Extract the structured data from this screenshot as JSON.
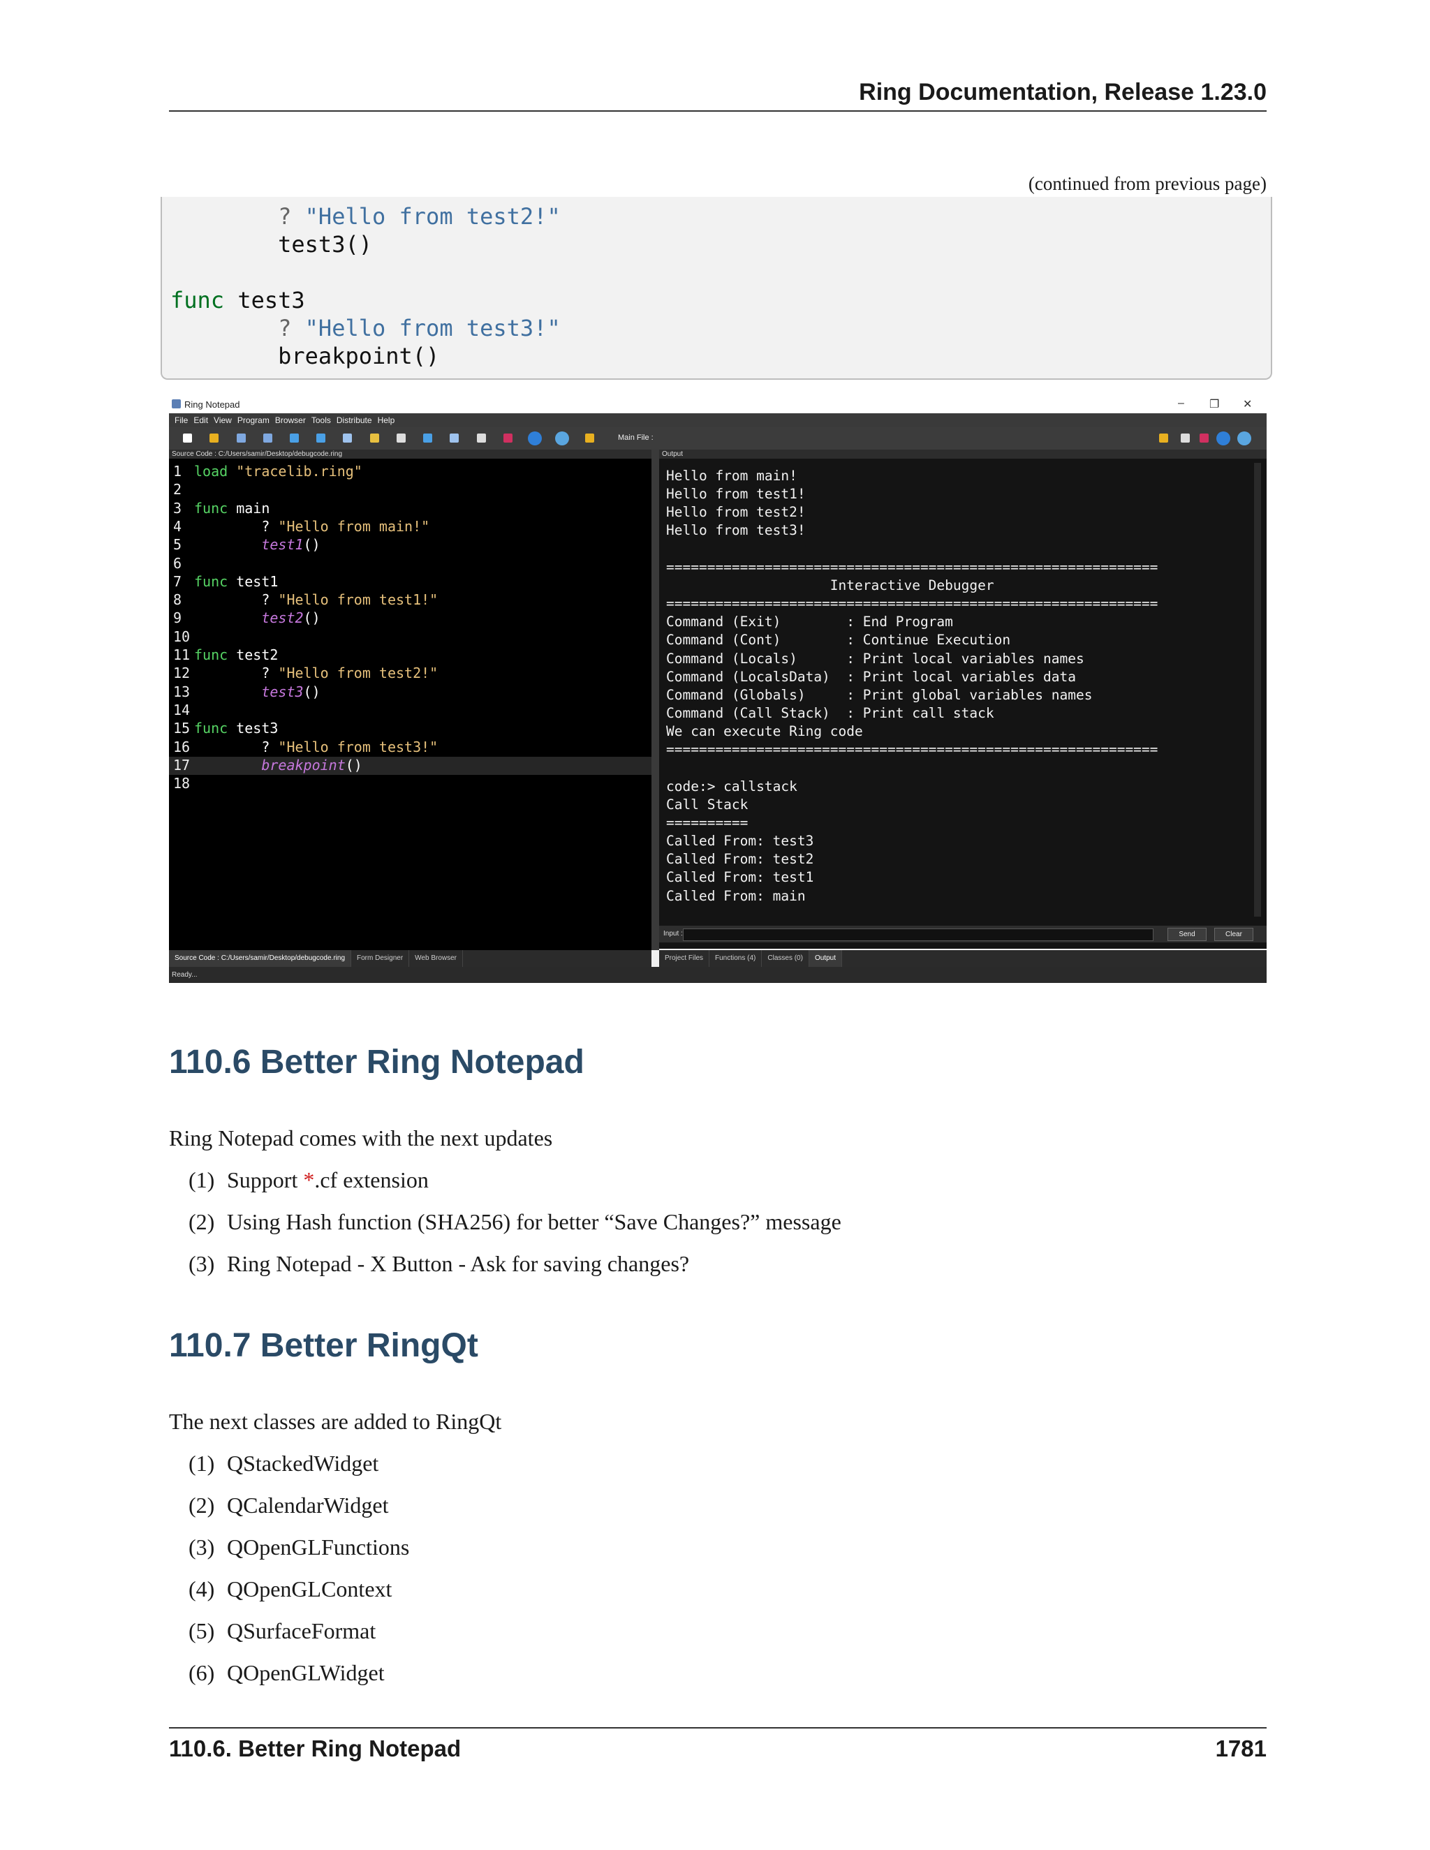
{
  "header": {
    "title": "Ring Documentation, Release 1.23.0"
  },
  "continued_note": "(continued from previous page)",
  "code_block": [
    {
      "indent": "        ",
      "parts": [
        {
          "t": "? ",
          "c": "op"
        },
        {
          "t": "\"Hello from test2!\"",
          "c": "str"
        }
      ]
    },
    {
      "indent": "        ",
      "parts": [
        {
          "t": "test3()",
          "c": ""
        }
      ]
    },
    {
      "indent": "",
      "parts": []
    },
    {
      "indent": "",
      "parts": [
        {
          "t": "func",
          "c": "kw"
        },
        {
          "t": " test3",
          "c": ""
        }
      ]
    },
    {
      "indent": "        ",
      "parts": [
        {
          "t": "? ",
          "c": "op"
        },
        {
          "t": "\"Hello from test3!\"",
          "c": "str"
        }
      ]
    },
    {
      "indent": "        ",
      "parts": [
        {
          "t": "breakpoint()",
          "c": ""
        }
      ]
    }
  ],
  "screenshot": {
    "window_title": "Ring Notepad",
    "menu": [
      "File",
      "Edit",
      "View",
      "Program",
      "Browser",
      "Tools",
      "Distribute",
      "Help"
    ],
    "main_file_label": "Main File :",
    "source_header": "Source Code : C:/Users/samir/Desktop/debugcode.ring",
    "output_header": "Output",
    "editor_lines": [
      {
        "n": "1",
        "parts": [
          {
            "t": "load",
            "c": "c-kw"
          },
          {
            "t": " ",
            "c": ""
          },
          {
            "t": "\"tracelib.ring\"",
            "c": "c-str"
          }
        ]
      },
      {
        "n": "2",
        "parts": []
      },
      {
        "n": "3",
        "parts": [
          {
            "t": "func",
            "c": "c-kw"
          },
          {
            "t": " main",
            "c": ""
          }
        ]
      },
      {
        "n": "4",
        "parts": [
          {
            "t": "        ? ",
            "c": ""
          },
          {
            "t": "\"Hello from main!\"",
            "c": "c-str"
          }
        ]
      },
      {
        "n": "5",
        "parts": [
          {
            "t": "        ",
            "c": ""
          },
          {
            "t": "test1",
            "c": "c-fn"
          },
          {
            "t": "()",
            "c": ""
          }
        ]
      },
      {
        "n": "6",
        "parts": []
      },
      {
        "n": "7",
        "parts": [
          {
            "t": "func",
            "c": "c-kw"
          },
          {
            "t": " test1",
            "c": ""
          }
        ]
      },
      {
        "n": "8",
        "parts": [
          {
            "t": "        ? ",
            "c": ""
          },
          {
            "t": "\"Hello from test1!\"",
            "c": "c-str"
          }
        ]
      },
      {
        "n": "9",
        "parts": [
          {
            "t": "        ",
            "c": ""
          },
          {
            "t": "test2",
            "c": "c-fn"
          },
          {
            "t": "()",
            "c": ""
          }
        ]
      },
      {
        "n": "10",
        "parts": []
      },
      {
        "n": "11",
        "parts": [
          {
            "t": "func",
            "c": "c-kw"
          },
          {
            "t": " test2",
            "c": ""
          }
        ]
      },
      {
        "n": "12",
        "parts": [
          {
            "t": "        ? ",
            "c": ""
          },
          {
            "t": "\"Hello from test2!\"",
            "c": "c-str"
          }
        ]
      },
      {
        "n": "13",
        "parts": [
          {
            "t": "        ",
            "c": ""
          },
          {
            "t": "test3",
            "c": "c-fn"
          },
          {
            "t": "()",
            "c": ""
          }
        ]
      },
      {
        "n": "14",
        "parts": []
      },
      {
        "n": "15",
        "parts": [
          {
            "t": "func",
            "c": "c-kw"
          },
          {
            "t": " test3",
            "c": ""
          }
        ]
      },
      {
        "n": "16",
        "parts": [
          {
            "t": "        ? ",
            "c": ""
          },
          {
            "t": "\"Hello from test3!\"",
            "c": "c-str"
          }
        ]
      },
      {
        "n": "17",
        "hl": true,
        "parts": [
          {
            "t": "        ",
            "c": ""
          },
          {
            "t": "breakpoint",
            "c": "c-fn"
          },
          {
            "t": "()",
            "c": ""
          }
        ]
      },
      {
        "n": "18",
        "parts": []
      }
    ],
    "output_text": "Hello from main!\nHello from test1!\nHello from test2!\nHello from test3!\n\n============================================================\n                    Interactive Debugger\n============================================================\nCommand (Exit)        : End Program\nCommand (Cont)        : Continue Execution\nCommand (Locals)      : Print local variables names\nCommand (LocalsData)  : Print local variables data\nCommand (Globals)     : Print global variables names\nCommand (Call Stack)  : Print call stack\nWe can execute Ring code\n============================================================\n\ncode:> callstack\nCall Stack\n==========\nCalled From: test3\nCalled From: test2\nCalled From: test1\nCalled From: main",
    "input_label": "Input :",
    "send_label": "Send",
    "clear_label": "Clear",
    "left_tabs": [
      "Source Code : C:/Users/samir/Desktop/debugcode.ring",
      "Form Designer",
      "Web Browser"
    ],
    "right_tabs": [
      "Project Files",
      "Functions (4)",
      "Classes (0)",
      "Output"
    ],
    "status": "Ready..."
  },
  "section1": {
    "title": "110.6  Better Ring Notepad",
    "intro": "Ring Notepad comes with the next updates",
    "items": [
      {
        "n": "(1)",
        "pre": "Support ",
        "red": "*",
        "post": ".cf extension"
      },
      {
        "n": "(2)",
        "pre": "Using Hash function (SHA256) for better “Save Changes?” message",
        "red": "",
        "post": ""
      },
      {
        "n": "(3)",
        "pre": "Ring Notepad - X Button - Ask for saving changes?",
        "red": "",
        "post": ""
      }
    ]
  },
  "section2": {
    "title": "110.7  Better RingQt",
    "intro": "The next classes are added to RingQt",
    "items": [
      {
        "n": "(1)",
        "text": "QStackedWidget"
      },
      {
        "n": "(2)",
        "text": "QCalendarWidget"
      },
      {
        "n": "(3)",
        "text": "QOpenGLFunctions"
      },
      {
        "n": "(4)",
        "text": "QOpenGLContext"
      },
      {
        "n": "(5)",
        "text": "QSurfaceFormat"
      },
      {
        "n": "(6)",
        "text": "QOpenGLWidget"
      }
    ]
  },
  "footer": {
    "left": "110.6.  Better Ring Notepad",
    "right": "1781"
  }
}
